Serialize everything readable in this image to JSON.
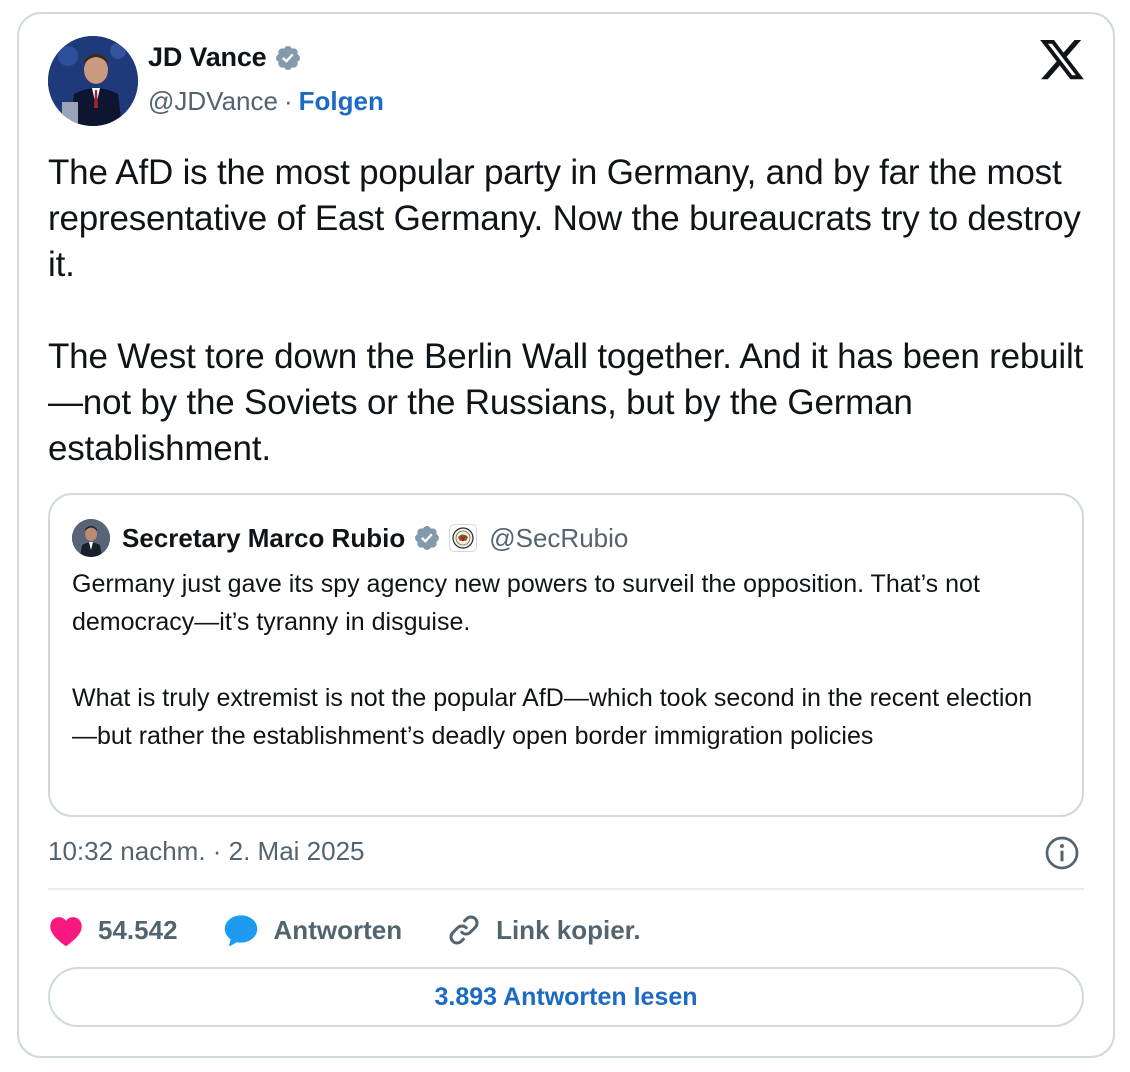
{
  "author": {
    "name": "JD Vance",
    "handle": "@JDVance",
    "separator": "·",
    "follow_label": "Folgen"
  },
  "tweet": {
    "paragraphs": [
      "The AfD is the most popular party in Germany, and by far the most representative of East Germany. Now the bureaucrats try to destroy it.",
      "The West tore down the Berlin Wall together. And it has been rebuilt—not by the Soviets or the Russians, but by the German establishment."
    ]
  },
  "quoted_tweet": {
    "name": "Secretary Marco Rubio",
    "handle": "@SecRubio",
    "paragraphs": [
      "Germany just gave its spy agency new powers to surveil the opposition. That’s not democracy—it’s tyranny in disguise.",
      "What is truly extremist is not the popular AfD—which took second in the recent election—but rather the establishment’s deadly open border immigration policies"
    ]
  },
  "timestamp": "10:32 nachm. · 2. Mai 2025",
  "actions": {
    "like_count": "54.542",
    "reply_label": "Antworten",
    "copy_link_label": "Link kopier."
  },
  "read_replies_label": "3.893 Antworten lesen",
  "colors": {
    "verified": "#829aab",
    "link": "#1d6ac4",
    "like": "#f91880",
    "reply": "#1d9bf0",
    "muted": "#536471",
    "border": "#cfd9de"
  },
  "icons": [
    "verified-badge-icon",
    "x-logo-icon",
    "info-icon",
    "heart-icon",
    "reply-bubble-icon",
    "link-icon",
    "state-department-seal-icon"
  ]
}
